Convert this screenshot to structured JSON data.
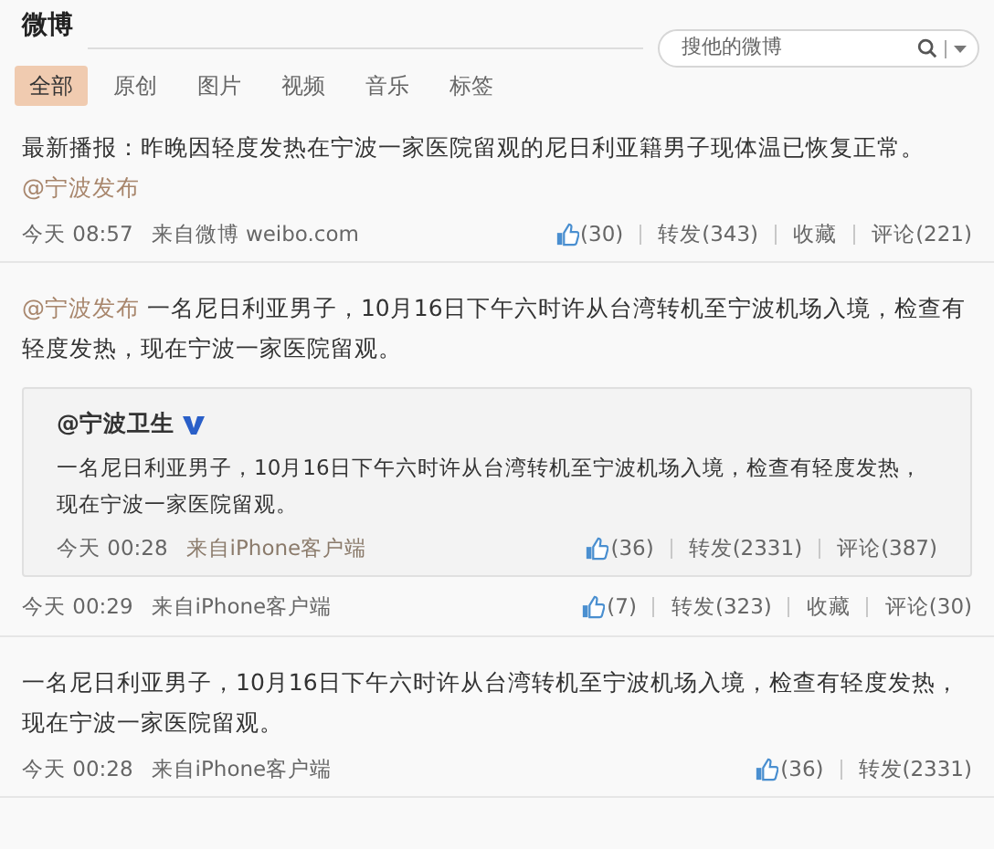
{
  "header": {
    "title": "微博",
    "search": {
      "placeholder": "搜他的微博"
    }
  },
  "tabs": [
    {
      "label": "全部",
      "selected": true
    },
    {
      "label": "原创",
      "selected": false
    },
    {
      "label": "图片",
      "selected": false
    },
    {
      "label": "视频",
      "selected": false
    },
    {
      "label": "音乐",
      "selected": false
    },
    {
      "label": "标签",
      "selected": false
    }
  ],
  "posts": [
    {
      "segments": [
        {
          "kind": "text",
          "text": "最新播报：昨晚因轻度发热在宁波一家医院留观的尼日利亚籍男子现体温已恢复正常。"
        },
        {
          "kind": "mention",
          "text": "@宁波发布"
        }
      ],
      "time": "今天 08:57",
      "source": "来自微博 weibo.com",
      "actions": [
        {
          "kind": "like",
          "label": "(30)"
        },
        {
          "kind": "link",
          "label": "转发(343)"
        },
        {
          "kind": "link",
          "label": "收藏"
        },
        {
          "kind": "link",
          "label": "评论(221)"
        }
      ]
    },
    {
      "segments": [
        {
          "kind": "mention",
          "text": "@宁波发布"
        },
        {
          "kind": "text",
          "text": " 一名尼日利亚男子，10月16日下午六时许从台湾转机至宁波机场入境，检查有轻度发热，现在宁波一家医院留观。"
        }
      ],
      "repost": {
        "author": "@宁波卫生",
        "verified": true,
        "text": "一名尼日利亚男子，10月16日下午六时许从台湾转机至宁波机场入境，检查有轻度发热，现在宁波一家医院留观。",
        "time": "今天 00:28",
        "source": "来自iPhone客户端",
        "actions": [
          {
            "kind": "like",
            "label": "(36)"
          },
          {
            "kind": "link",
            "label": "转发(2331)"
          },
          {
            "kind": "link",
            "label": "评论(387)"
          }
        ]
      },
      "time": "今天 00:29",
      "source": "来自iPhone客户端",
      "actions": [
        {
          "kind": "like",
          "label": "(7)"
        },
        {
          "kind": "link",
          "label": "转发(323)"
        },
        {
          "kind": "link",
          "label": "收藏"
        },
        {
          "kind": "link",
          "label": "评论(30)"
        }
      ]
    },
    {
      "segments": [
        {
          "kind": "text",
          "text": "一名尼日利亚男子，10月16日下午六时许从台湾转机至宁波机场入境，检查有轻度发热，现在宁波一家医院留观。"
        }
      ],
      "time": "今天 00:28",
      "source": "来自iPhone客户端",
      "actions": [
        {
          "kind": "like",
          "label": "(36)"
        },
        {
          "kind": "link",
          "label": "转发(2331)"
        }
      ]
    }
  ]
}
